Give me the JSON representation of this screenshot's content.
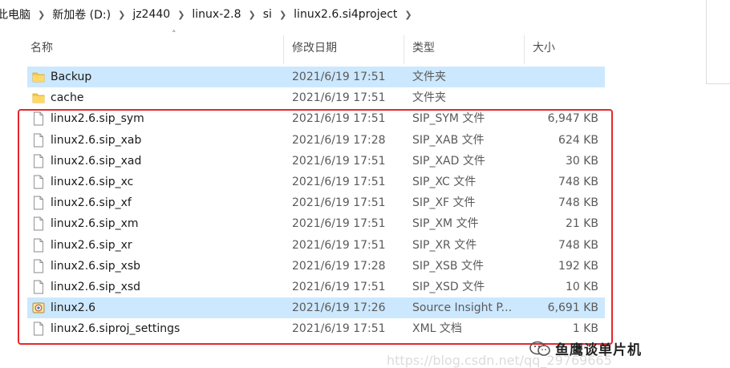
{
  "breadcrumb": [
    "此电脑",
    "新加卷 (D:)",
    "jz2440",
    "linux-2.8",
    "si",
    "linux2.6.si4project"
  ],
  "columns": {
    "name": "名称",
    "date": "修改日期",
    "type": "类型",
    "size": "大小"
  },
  "files": [
    {
      "icon": "folder-icon",
      "name": "Backup",
      "date": "2021/6/19 17:51",
      "type": "文件夹",
      "size": "",
      "selected": true
    },
    {
      "icon": "folder-icon",
      "name": "cache",
      "date": "2021/6/19 17:51",
      "type": "文件夹",
      "size": "",
      "selected": false
    },
    {
      "icon": "file-icon",
      "name": "linux2.6.sip_sym",
      "date": "2021/6/19 17:51",
      "type": "SIP_SYM 文件",
      "size": "6,947 KB",
      "selected": false
    },
    {
      "icon": "file-icon",
      "name": "linux2.6.sip_xab",
      "date": "2021/6/19 17:28",
      "type": "SIP_XAB 文件",
      "size": "624 KB",
      "selected": false
    },
    {
      "icon": "file-icon",
      "name": "linux2.6.sip_xad",
      "date": "2021/6/19 17:51",
      "type": "SIP_XAD 文件",
      "size": "30 KB",
      "selected": false
    },
    {
      "icon": "file-icon",
      "name": "linux2.6.sip_xc",
      "date": "2021/6/19 17:51",
      "type": "SIP_XC 文件",
      "size": "748 KB",
      "selected": false
    },
    {
      "icon": "file-icon",
      "name": "linux2.6.sip_xf",
      "date": "2021/6/19 17:51",
      "type": "SIP_XF 文件",
      "size": "748 KB",
      "selected": false
    },
    {
      "icon": "file-icon",
      "name": "linux2.6.sip_xm",
      "date": "2021/6/19 17:51",
      "type": "SIP_XM 文件",
      "size": "21 KB",
      "selected": false
    },
    {
      "icon": "file-icon",
      "name": "linux2.6.sip_xr",
      "date": "2021/6/19 17:51",
      "type": "SIP_XR 文件",
      "size": "748 KB",
      "selected": false
    },
    {
      "icon": "file-icon",
      "name": "linux2.6.sip_xsb",
      "date": "2021/6/19 17:28",
      "type": "SIP_XSB 文件",
      "size": "192 KB",
      "selected": false
    },
    {
      "icon": "file-icon",
      "name": "linux2.6.sip_xsd",
      "date": "2021/6/19 17:51",
      "type": "SIP_XSD 文件",
      "size": "10 KB",
      "selected": false
    },
    {
      "icon": "source-insight-project-icon",
      "name": "linux2.6",
      "date": "2021/6/19 17:26",
      "type": "Source Insight P...",
      "size": "6,691 KB",
      "selected": true
    },
    {
      "icon": "file-icon",
      "name": "linux2.6.siproj_settings",
      "date": "2021/6/19 17:51",
      "type": "XML 文档",
      "size": "1 KB",
      "selected": false
    }
  ],
  "highlight_color": "#e8262c",
  "selection_color": "#cce8ff",
  "watermark": "https://blog.csdn.net/qq_29769665",
  "wechat_label": "鱼鹰谈单片机"
}
